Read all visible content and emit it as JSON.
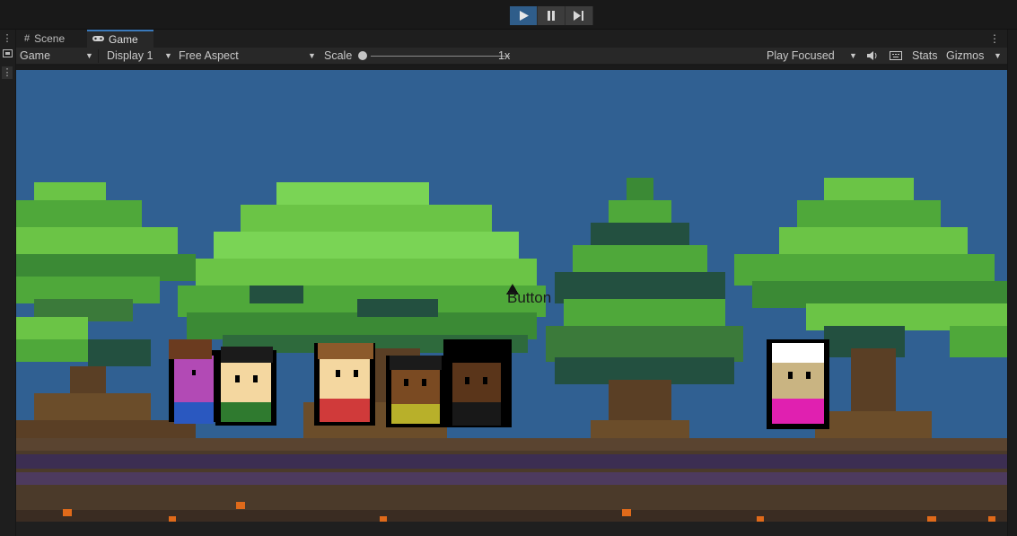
{
  "toolbar": {
    "play_icon": "play-icon",
    "pause_icon": "pause-icon",
    "step_icon": "step-icon",
    "accent": "#2f5d8a"
  },
  "tabs": [
    {
      "label": "Scene",
      "icon": "grid-icon"
    },
    {
      "label": "Game",
      "icon": "gamepad-icon"
    }
  ],
  "options": {
    "view": "Game",
    "display": "Display 1",
    "aspect": "Free Aspect",
    "scale_label": "Scale",
    "scale_value": "1x",
    "play_mode": "Play Focused",
    "stats": "Stats",
    "gizmos": "Gizmos"
  },
  "game": {
    "sky_color": "#306092",
    "canvas_text": "Button",
    "characters": [
      "purple-haired",
      "dark-haired-green",
      "brown-haired-red",
      "curly-yellow",
      "afro-black",
      "white-haired-pink"
    ]
  }
}
